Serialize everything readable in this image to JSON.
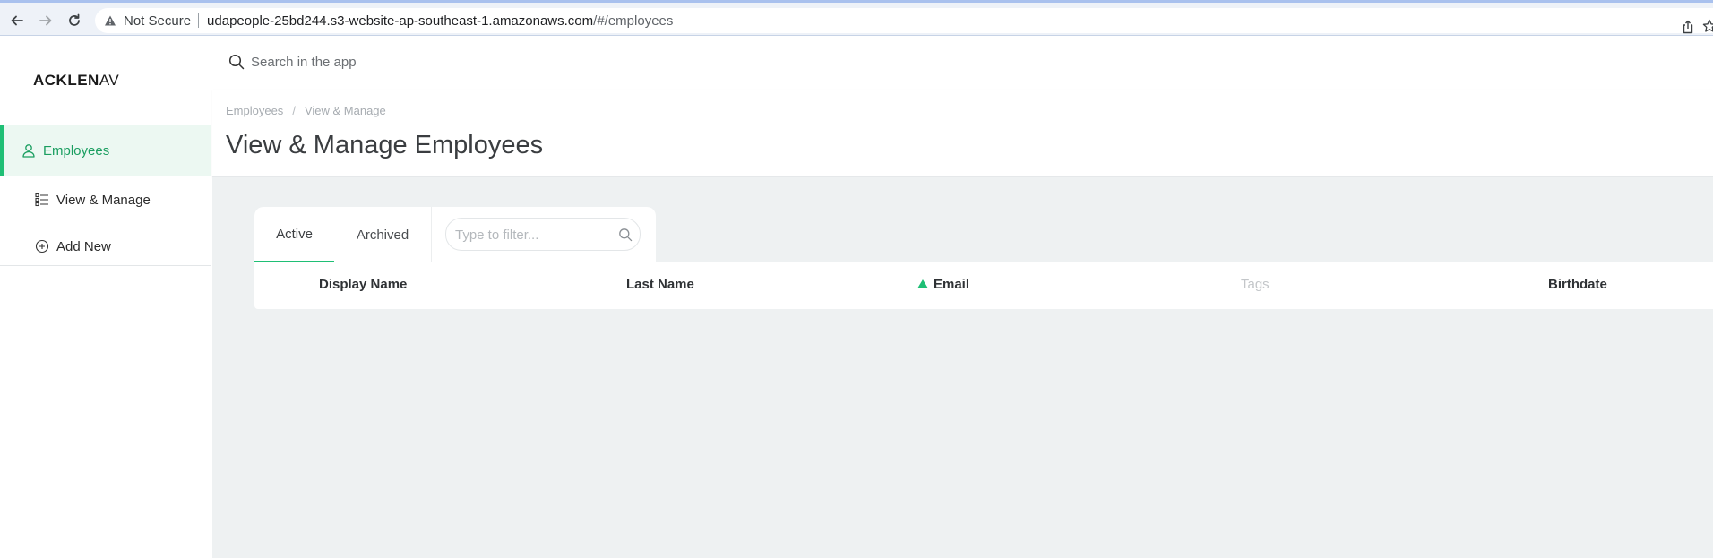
{
  "browser": {
    "security_label": "Not Secure",
    "url_host": "udapeople-25bd244.s3-website-ap-southeast-1.amazonaws.com",
    "url_path": "/#/employees"
  },
  "sidebar": {
    "logo_bold": "ACKLEN",
    "logo_light": "AV",
    "items": [
      {
        "label": "Employees",
        "icon": "user-icon"
      },
      {
        "label": "View & Manage",
        "icon": "list-icon"
      },
      {
        "label": "Add New",
        "icon": "plus-circle-icon"
      }
    ]
  },
  "topbar": {
    "search_placeholder": "Search in the app"
  },
  "header": {
    "breadcrumb": [
      "Employees",
      "View & Manage"
    ],
    "breadcrumb_sep": "/",
    "title": "View & Manage Employees"
  },
  "tabs": [
    {
      "label": "Active",
      "selected": true
    },
    {
      "label": "Archived",
      "selected": false
    }
  ],
  "filter": {
    "placeholder": "Type to filter..."
  },
  "table": {
    "columns": [
      {
        "label": "Display Name"
      },
      {
        "label": "Last Name"
      },
      {
        "label": "Email",
        "sorted": "asc"
      },
      {
        "label": "Tags",
        "disabled": true
      },
      {
        "label": "Birthdate"
      }
    ]
  },
  "colors": {
    "accent": "#1fbf75",
    "active_bg": "#ecf8f2",
    "content_bg": "#eef1f2"
  }
}
